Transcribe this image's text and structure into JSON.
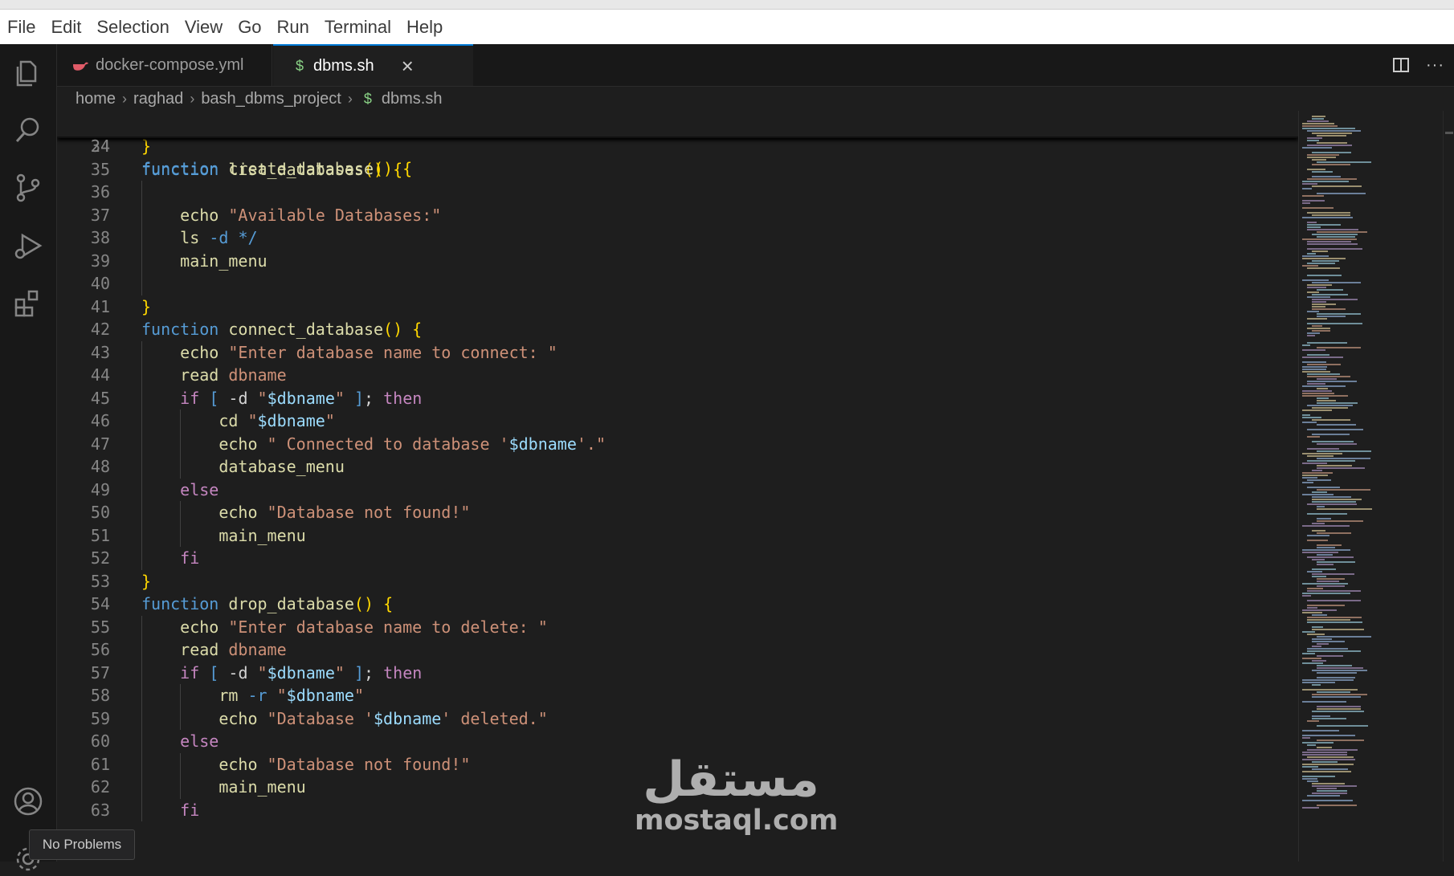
{
  "menu": [
    "File",
    "Edit",
    "Selection",
    "View",
    "Go",
    "Run",
    "Terminal",
    "Help"
  ],
  "tabs": [
    {
      "label": "docker-compose.yml",
      "icon": "whale-icon",
      "active": false
    },
    {
      "label": "dbms.sh",
      "icon": "dollar-icon",
      "active": true,
      "close": "×"
    }
  ],
  "breadcrumb": {
    "parts": [
      "home",
      "raghad",
      "bash_dbms_project",
      "dbms.sh"
    ],
    "file_icon": "$"
  },
  "sticky": {
    "line_number": "24",
    "text": "function create_database() {"
  },
  "lines": [
    {
      "n": "34",
      "indent": 0
    },
    {
      "n": "35",
      "indent": 0
    },
    {
      "n": "36",
      "indent": 1
    },
    {
      "n": "37",
      "indent": 1
    },
    {
      "n": "38",
      "indent": 1
    },
    {
      "n": "39",
      "indent": 1
    },
    {
      "n": "40",
      "indent": 1
    },
    {
      "n": "41",
      "indent": 0
    },
    {
      "n": "42",
      "indent": 0
    },
    {
      "n": "43",
      "indent": 1
    },
    {
      "n": "44",
      "indent": 1
    },
    {
      "n": "45",
      "indent": 1
    },
    {
      "n": "46",
      "indent": 2
    },
    {
      "n": "47",
      "indent": 2
    },
    {
      "n": "48",
      "indent": 2
    },
    {
      "n": "49",
      "indent": 1
    },
    {
      "n": "50",
      "indent": 2
    },
    {
      "n": "51",
      "indent": 2
    },
    {
      "n": "52",
      "indent": 1
    },
    {
      "n": "53",
      "indent": 0
    },
    {
      "n": "54",
      "indent": 0
    },
    {
      "n": "55",
      "indent": 1
    },
    {
      "n": "56",
      "indent": 1
    },
    {
      "n": "57",
      "indent": 1
    },
    {
      "n": "58",
      "indent": 2
    },
    {
      "n": "59",
      "indent": 2
    },
    {
      "n": "60",
      "indent": 1
    },
    {
      "n": "61",
      "indent": 2
    },
    {
      "n": "62",
      "indent": 2
    },
    {
      "n": "63",
      "indent": 1
    }
  ],
  "tokens": {
    "34": [
      [
        "b",
        "}"
      ]
    ],
    "35": [
      [
        "k",
        "function"
      ],
      [
        "o",
        " "
      ],
      [
        "f",
        "list_databases"
      ],
      [
        "b",
        "()"
      ],
      [
        "o",
        " "
      ],
      [
        "b",
        "{"
      ]
    ],
    "36": [],
    "37": [
      [
        "o",
        "    "
      ],
      [
        "f",
        "echo"
      ],
      [
        "o",
        " "
      ],
      [
        "s",
        "\"Available Databases:\""
      ]
    ],
    "38": [
      [
        "o",
        "    "
      ],
      [
        "f",
        "ls"
      ],
      [
        "o",
        " "
      ],
      [
        "p",
        "-d"
      ],
      [
        "o",
        " "
      ],
      [
        "p",
        "*/"
      ]
    ],
    "39": [
      [
        "o",
        "    "
      ],
      [
        "f",
        "main_menu"
      ]
    ],
    "40": [],
    "41": [
      [
        "b",
        "}"
      ]
    ],
    "42": [
      [
        "k",
        "function"
      ],
      [
        "o",
        " "
      ],
      [
        "f",
        "connect_database"
      ],
      [
        "b",
        "()"
      ],
      [
        "o",
        " "
      ],
      [
        "b",
        "{"
      ]
    ],
    "43": [
      [
        "o",
        "    "
      ],
      [
        "f",
        "echo"
      ],
      [
        "o",
        " "
      ],
      [
        "s",
        "\"Enter database name to connect: \""
      ]
    ],
    "44": [
      [
        "o",
        "    "
      ],
      [
        "f",
        "read"
      ],
      [
        "o",
        " "
      ],
      [
        "s",
        "dbname"
      ]
    ],
    "45": [
      [
        "o",
        "    "
      ],
      [
        "c",
        "if"
      ],
      [
        "o",
        " "
      ],
      [
        "p",
        "["
      ],
      [
        "o",
        " "
      ],
      [
        "o",
        "-d"
      ],
      [
        "o",
        " "
      ],
      [
        "s",
        "\""
      ],
      [
        "v",
        "$dbname"
      ],
      [
        "s",
        "\""
      ],
      [
        "o",
        " "
      ],
      [
        "p",
        "]"
      ],
      [
        "o",
        "; "
      ],
      [
        "c",
        "then"
      ]
    ],
    "46": [
      [
        "o",
        "        "
      ],
      [
        "f",
        "cd"
      ],
      [
        "o",
        " "
      ],
      [
        "s",
        "\""
      ],
      [
        "v",
        "$dbname"
      ],
      [
        "s",
        "\""
      ]
    ],
    "47": [
      [
        "o",
        "        "
      ],
      [
        "f",
        "echo"
      ],
      [
        "o",
        " "
      ],
      [
        "s",
        "\" Connected to database '"
      ],
      [
        "v",
        "$dbname"
      ],
      [
        "s",
        "'.\""
      ]
    ],
    "48": [
      [
        "o",
        "        "
      ],
      [
        "f",
        "database_menu"
      ]
    ],
    "49": [
      [
        "o",
        "    "
      ],
      [
        "c",
        "else"
      ]
    ],
    "50": [
      [
        "o",
        "        "
      ],
      [
        "f",
        "echo"
      ],
      [
        "o",
        " "
      ],
      [
        "s",
        "\"Database not found!\""
      ]
    ],
    "51": [
      [
        "o",
        "        "
      ],
      [
        "f",
        "main_menu"
      ]
    ],
    "52": [
      [
        "o",
        "    "
      ],
      [
        "c",
        "fi"
      ]
    ],
    "53": [
      [
        "b",
        "}"
      ]
    ],
    "54": [
      [
        "k",
        "function"
      ],
      [
        "o",
        " "
      ],
      [
        "f",
        "drop_database"
      ],
      [
        "b",
        "()"
      ],
      [
        "o",
        " "
      ],
      [
        "b",
        "{"
      ]
    ],
    "55": [
      [
        "o",
        "    "
      ],
      [
        "f",
        "echo"
      ],
      [
        "o",
        " "
      ],
      [
        "s",
        "\"Enter database name to delete: \""
      ]
    ],
    "56": [
      [
        "o",
        "    "
      ],
      [
        "f",
        "read"
      ],
      [
        "o",
        " "
      ],
      [
        "s",
        "dbname"
      ]
    ],
    "57": [
      [
        "o",
        "    "
      ],
      [
        "c",
        "if"
      ],
      [
        "o",
        " "
      ],
      [
        "p",
        "["
      ],
      [
        "o",
        " "
      ],
      [
        "o",
        "-d"
      ],
      [
        "o",
        " "
      ],
      [
        "s",
        "\""
      ],
      [
        "v",
        "$dbname"
      ],
      [
        "s",
        "\""
      ],
      [
        "o",
        " "
      ],
      [
        "p",
        "]"
      ],
      [
        "o",
        "; "
      ],
      [
        "c",
        "then"
      ]
    ],
    "58": [
      [
        "o",
        "        "
      ],
      [
        "f",
        "rm"
      ],
      [
        "o",
        " "
      ],
      [
        "p",
        "-r"
      ],
      [
        "o",
        " "
      ],
      [
        "s",
        "\""
      ],
      [
        "v",
        "$dbname"
      ],
      [
        "s",
        "\""
      ]
    ],
    "59": [
      [
        "o",
        "        "
      ],
      [
        "f",
        "echo"
      ],
      [
        "o",
        " "
      ],
      [
        "s",
        "\"Database '"
      ],
      [
        "v",
        "$dbname"
      ],
      [
        "s",
        "' deleted.\""
      ]
    ],
    "60": [
      [
        "o",
        "    "
      ],
      [
        "c",
        "else"
      ]
    ],
    "61": [
      [
        "o",
        "        "
      ],
      [
        "f",
        "echo"
      ],
      [
        "o",
        " "
      ],
      [
        "s",
        "\"Database not found!\""
      ]
    ],
    "62": [
      [
        "o",
        "        "
      ],
      [
        "f",
        "main_menu"
      ]
    ],
    "63": [
      [
        "o",
        "    "
      ],
      [
        "c",
        "fi"
      ]
    ]
  },
  "watermark": {
    "arabic": "مستقل",
    "latin": "mostaql.com"
  },
  "tooltip": "No Problems",
  "colors": {
    "keyword": "#569cd6",
    "function": "#dcdcaa",
    "string": "#ce9178",
    "variable": "#9cdcfe",
    "control": "#c586c0",
    "bracket": "#ffd700",
    "accent": "#0078d4"
  }
}
